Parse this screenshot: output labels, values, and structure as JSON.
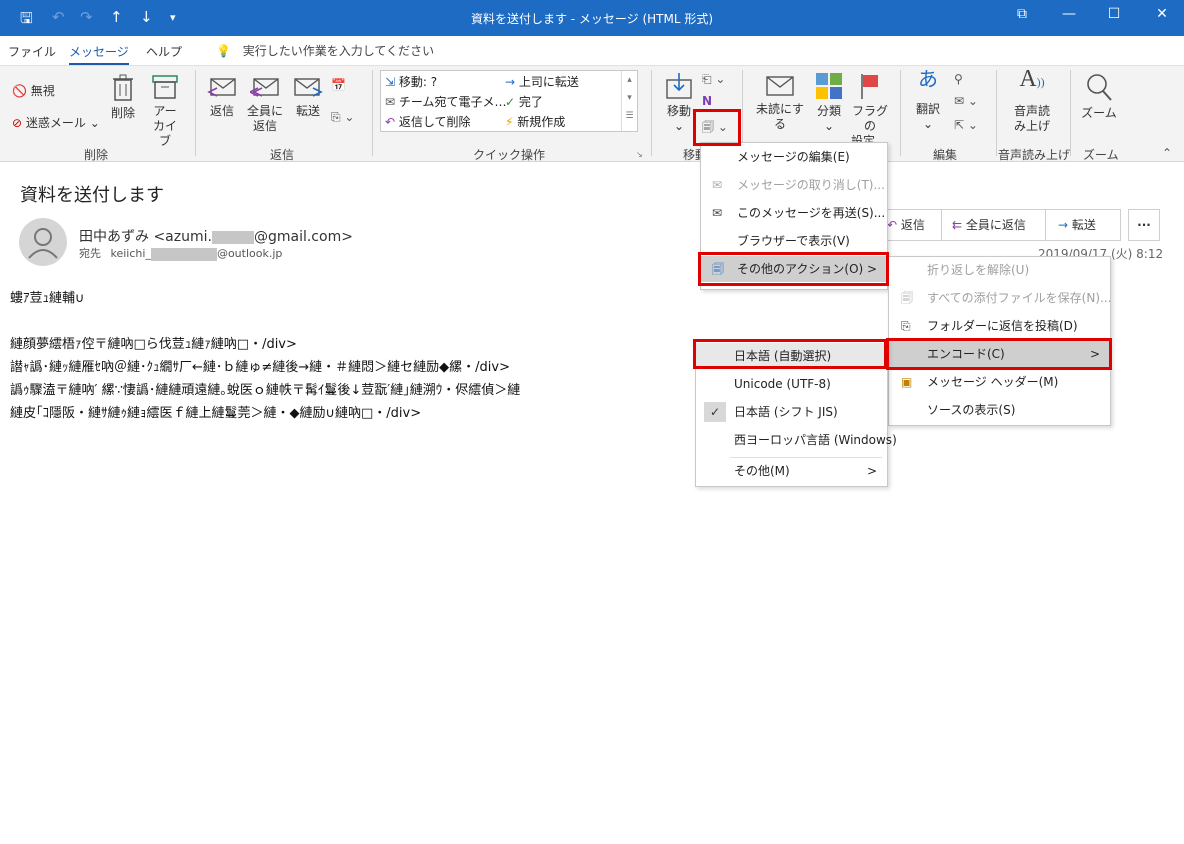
{
  "window": {
    "title": "資料を送付します - メッセージ (HTML 形式)",
    "minimize": "—",
    "maximize": "☐",
    "close": "✕",
    "restore": "⧉"
  },
  "tabs": [
    {
      "label": "ファイル"
    },
    {
      "label": "メッセージ"
    },
    {
      "label": "ヘルプ"
    }
  ],
  "tell_me": "実行したい作業を入力してください",
  "ribbon": {
    "delete_group": {
      "ignore": "無視",
      "junk": "迷惑メール",
      "delete": "削除",
      "archive_1": "アー",
      "archive_2": "カイブ",
      "label": "削除"
    },
    "respond_group": {
      "reply": "返信",
      "reply_all_1": "全員に",
      "reply_all_2": "返信",
      "forward": "転送",
      "label": "返信"
    },
    "quick_steps": {
      "items": [
        "移動: ?",
        "チーム宛て電子メ…",
        "返信して削除",
        "上司に転送",
        "完了",
        "新規作成"
      ],
      "label": "クイック操作"
    },
    "move_group": {
      "move": "移動",
      "label": "移動"
    },
    "tags_group": {
      "unread": "未読にする",
      "categorize": "分類",
      "flag_1": "フラグの",
      "flag_2": "設定"
    },
    "edit_group": {
      "translate": "翻訳",
      "label": "編集"
    },
    "speech_group": {
      "read_1": "音声読",
      "read_2": "み上げ",
      "label": "音声読み上げ"
    },
    "zoom_group": {
      "zoom": "ズーム",
      "label": "ズーム"
    }
  },
  "message": {
    "subject": "資料を送付します",
    "sender_prefix": "田中あずみ <azumi.",
    "sender_suffix": "@gmail.com>",
    "to_label": "宛先",
    "to_prefix": "keiichi_",
    "to_suffix": "@outlook.jp",
    "reply": "返信",
    "reply_all": "全員に返信",
    "forward": "転送",
    "more": "···",
    "date": "2019/09/17 (火) 8:12",
    "body_lines": [
      "螻ｱ荳ｭ縺輔∪",
      "",
      "縺顔夢繧梧ｧ倥〒縺吶□ら伐荳ｭ縺ｧ縺吶□・/div>",
      "譛ｬ譌･縺ｯ縺雁ｾ吶＠縺･ｸｭ繝ｻ厂←縺･ｂ縺ゅ≠縺後→縺・＃縺悶＞縺セ縺励◆縲・/div>",
      "譌ｩ驟溘〒縺吶′ 縲∵悽譌･縺縺頑遠縺｡蛻医ｏ縺帙〒髯ｲ鬘後↓荳翫′縺｣縺溯ｳ・侭繧偵＞縺",
      "縺皮｢ｺ隱阪・縺ｻ縺ｩ縺ｮ繧医ｆ縺上縺鬘莞＞縺・◆縺励∪縺吶□・/div>"
    ]
  },
  "menu_more": {
    "items": [
      "メッセージの編集(E)",
      "メッセージの取り消し(T)...",
      "このメッセージを再送(S)...",
      "ブラウザーで表示(V)",
      "その他のアクション(O)"
    ]
  },
  "menu_other_actions": {
    "items": [
      "折り返しを解除(U)",
      "すべての添付ファイルを保存(N)...",
      "フォルダーに返信を投稿(D)",
      "エンコード(C)",
      "メッセージ ヘッダー(M)",
      "ソースの表示(S)"
    ]
  },
  "menu_encoding": {
    "items": [
      "日本語 (自動選択)",
      "Unicode (UTF-8)",
      "日本語 (シフト JIS)",
      "西ヨーロッパ言語 (Windows)",
      "その他(M)"
    ],
    "check": "✓"
  },
  "colors": {
    "titlebar": "#1e6bc4",
    "accent": "#1e5aa8",
    "highlight_box": "#e00000"
  }
}
